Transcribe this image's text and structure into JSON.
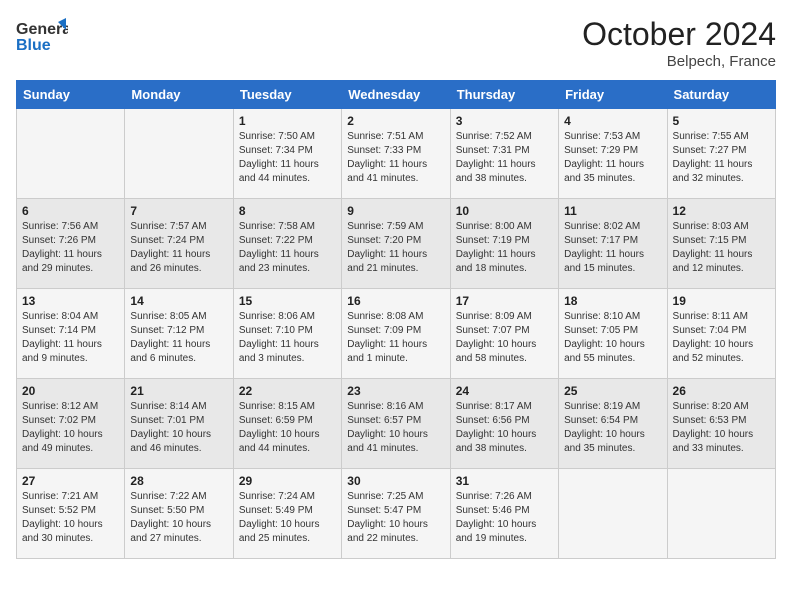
{
  "header": {
    "logo_general": "General",
    "logo_blue": "Blue",
    "month": "October 2024",
    "location": "Belpech, France"
  },
  "columns": [
    "Sunday",
    "Monday",
    "Tuesday",
    "Wednesday",
    "Thursday",
    "Friday",
    "Saturday"
  ],
  "weeks": [
    [
      {
        "day": "",
        "sunrise": "",
        "sunset": "",
        "daylight": ""
      },
      {
        "day": "",
        "sunrise": "",
        "sunset": "",
        "daylight": ""
      },
      {
        "day": "1",
        "sunrise": "Sunrise: 7:50 AM",
        "sunset": "Sunset: 7:34 PM",
        "daylight": "Daylight: 11 hours and 44 minutes."
      },
      {
        "day": "2",
        "sunrise": "Sunrise: 7:51 AM",
        "sunset": "Sunset: 7:33 PM",
        "daylight": "Daylight: 11 hours and 41 minutes."
      },
      {
        "day": "3",
        "sunrise": "Sunrise: 7:52 AM",
        "sunset": "Sunset: 7:31 PM",
        "daylight": "Daylight: 11 hours and 38 minutes."
      },
      {
        "day": "4",
        "sunrise": "Sunrise: 7:53 AM",
        "sunset": "Sunset: 7:29 PM",
        "daylight": "Daylight: 11 hours and 35 minutes."
      },
      {
        "day": "5",
        "sunrise": "Sunrise: 7:55 AM",
        "sunset": "Sunset: 7:27 PM",
        "daylight": "Daylight: 11 hours and 32 minutes."
      }
    ],
    [
      {
        "day": "6",
        "sunrise": "Sunrise: 7:56 AM",
        "sunset": "Sunset: 7:26 PM",
        "daylight": "Daylight: 11 hours and 29 minutes."
      },
      {
        "day": "7",
        "sunrise": "Sunrise: 7:57 AM",
        "sunset": "Sunset: 7:24 PM",
        "daylight": "Daylight: 11 hours and 26 minutes."
      },
      {
        "day": "8",
        "sunrise": "Sunrise: 7:58 AM",
        "sunset": "Sunset: 7:22 PM",
        "daylight": "Daylight: 11 hours and 23 minutes."
      },
      {
        "day": "9",
        "sunrise": "Sunrise: 7:59 AM",
        "sunset": "Sunset: 7:20 PM",
        "daylight": "Daylight: 11 hours and 21 minutes."
      },
      {
        "day": "10",
        "sunrise": "Sunrise: 8:00 AM",
        "sunset": "Sunset: 7:19 PM",
        "daylight": "Daylight: 11 hours and 18 minutes."
      },
      {
        "day": "11",
        "sunrise": "Sunrise: 8:02 AM",
        "sunset": "Sunset: 7:17 PM",
        "daylight": "Daylight: 11 hours and 15 minutes."
      },
      {
        "day": "12",
        "sunrise": "Sunrise: 8:03 AM",
        "sunset": "Sunset: 7:15 PM",
        "daylight": "Daylight: 11 hours and 12 minutes."
      }
    ],
    [
      {
        "day": "13",
        "sunrise": "Sunrise: 8:04 AM",
        "sunset": "Sunset: 7:14 PM",
        "daylight": "Daylight: 11 hours and 9 minutes."
      },
      {
        "day": "14",
        "sunrise": "Sunrise: 8:05 AM",
        "sunset": "Sunset: 7:12 PM",
        "daylight": "Daylight: 11 hours and 6 minutes."
      },
      {
        "day": "15",
        "sunrise": "Sunrise: 8:06 AM",
        "sunset": "Sunset: 7:10 PM",
        "daylight": "Daylight: 11 hours and 3 minutes."
      },
      {
        "day": "16",
        "sunrise": "Sunrise: 8:08 AM",
        "sunset": "Sunset: 7:09 PM",
        "daylight": "Daylight: 11 hours and 1 minute."
      },
      {
        "day": "17",
        "sunrise": "Sunrise: 8:09 AM",
        "sunset": "Sunset: 7:07 PM",
        "daylight": "Daylight: 10 hours and 58 minutes."
      },
      {
        "day": "18",
        "sunrise": "Sunrise: 8:10 AM",
        "sunset": "Sunset: 7:05 PM",
        "daylight": "Daylight: 10 hours and 55 minutes."
      },
      {
        "day": "19",
        "sunrise": "Sunrise: 8:11 AM",
        "sunset": "Sunset: 7:04 PM",
        "daylight": "Daylight: 10 hours and 52 minutes."
      }
    ],
    [
      {
        "day": "20",
        "sunrise": "Sunrise: 8:12 AM",
        "sunset": "Sunset: 7:02 PM",
        "daylight": "Daylight: 10 hours and 49 minutes."
      },
      {
        "day": "21",
        "sunrise": "Sunrise: 8:14 AM",
        "sunset": "Sunset: 7:01 PM",
        "daylight": "Daylight: 10 hours and 46 minutes."
      },
      {
        "day": "22",
        "sunrise": "Sunrise: 8:15 AM",
        "sunset": "Sunset: 6:59 PM",
        "daylight": "Daylight: 10 hours and 44 minutes."
      },
      {
        "day": "23",
        "sunrise": "Sunrise: 8:16 AM",
        "sunset": "Sunset: 6:57 PM",
        "daylight": "Daylight: 10 hours and 41 minutes."
      },
      {
        "day": "24",
        "sunrise": "Sunrise: 8:17 AM",
        "sunset": "Sunset: 6:56 PM",
        "daylight": "Daylight: 10 hours and 38 minutes."
      },
      {
        "day": "25",
        "sunrise": "Sunrise: 8:19 AM",
        "sunset": "Sunset: 6:54 PM",
        "daylight": "Daylight: 10 hours and 35 minutes."
      },
      {
        "day": "26",
        "sunrise": "Sunrise: 8:20 AM",
        "sunset": "Sunset: 6:53 PM",
        "daylight": "Daylight: 10 hours and 33 minutes."
      }
    ],
    [
      {
        "day": "27",
        "sunrise": "Sunrise: 7:21 AM",
        "sunset": "Sunset: 5:52 PM",
        "daylight": "Daylight: 10 hours and 30 minutes."
      },
      {
        "day": "28",
        "sunrise": "Sunrise: 7:22 AM",
        "sunset": "Sunset: 5:50 PM",
        "daylight": "Daylight: 10 hours and 27 minutes."
      },
      {
        "day": "29",
        "sunrise": "Sunrise: 7:24 AM",
        "sunset": "Sunset: 5:49 PM",
        "daylight": "Daylight: 10 hours and 25 minutes."
      },
      {
        "day": "30",
        "sunrise": "Sunrise: 7:25 AM",
        "sunset": "Sunset: 5:47 PM",
        "daylight": "Daylight: 10 hours and 22 minutes."
      },
      {
        "day": "31",
        "sunrise": "Sunrise: 7:26 AM",
        "sunset": "Sunset: 5:46 PM",
        "daylight": "Daylight: 10 hours and 19 minutes."
      },
      {
        "day": "",
        "sunrise": "",
        "sunset": "",
        "daylight": ""
      },
      {
        "day": "",
        "sunrise": "",
        "sunset": "",
        "daylight": ""
      }
    ]
  ]
}
